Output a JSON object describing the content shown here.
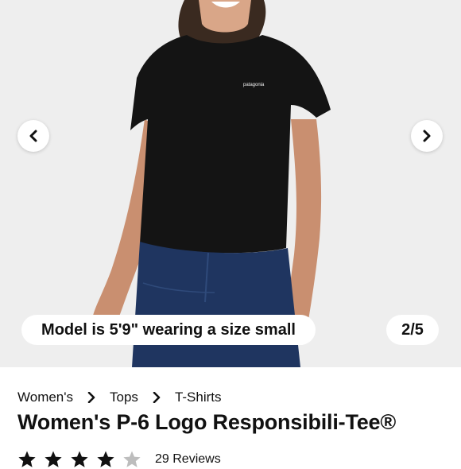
{
  "gallery": {
    "caption": "Model is 5'9\" wearing a size small",
    "counter": "2/5",
    "tee_logo": "patagonia",
    "prev_icon": "chevron-left-icon",
    "next_icon": "chevron-right-icon"
  },
  "breadcrumb": {
    "items": [
      "Women's",
      "Tops",
      "T-Shirts"
    ],
    "separator_icon": "chevron-right-icon"
  },
  "product": {
    "title": "Women's P-6 Logo Responsibili-Tee®",
    "rating": {
      "value": 4,
      "max": 5
    },
    "reviews_label": "29 Reviews"
  },
  "colors": {
    "background": "#ffffff",
    "gallery_bg": "#eeeeee",
    "shirt": "#141414",
    "jeans": "#1f3560",
    "star_filled": "#111111",
    "star_empty": "#bdbdbd"
  }
}
